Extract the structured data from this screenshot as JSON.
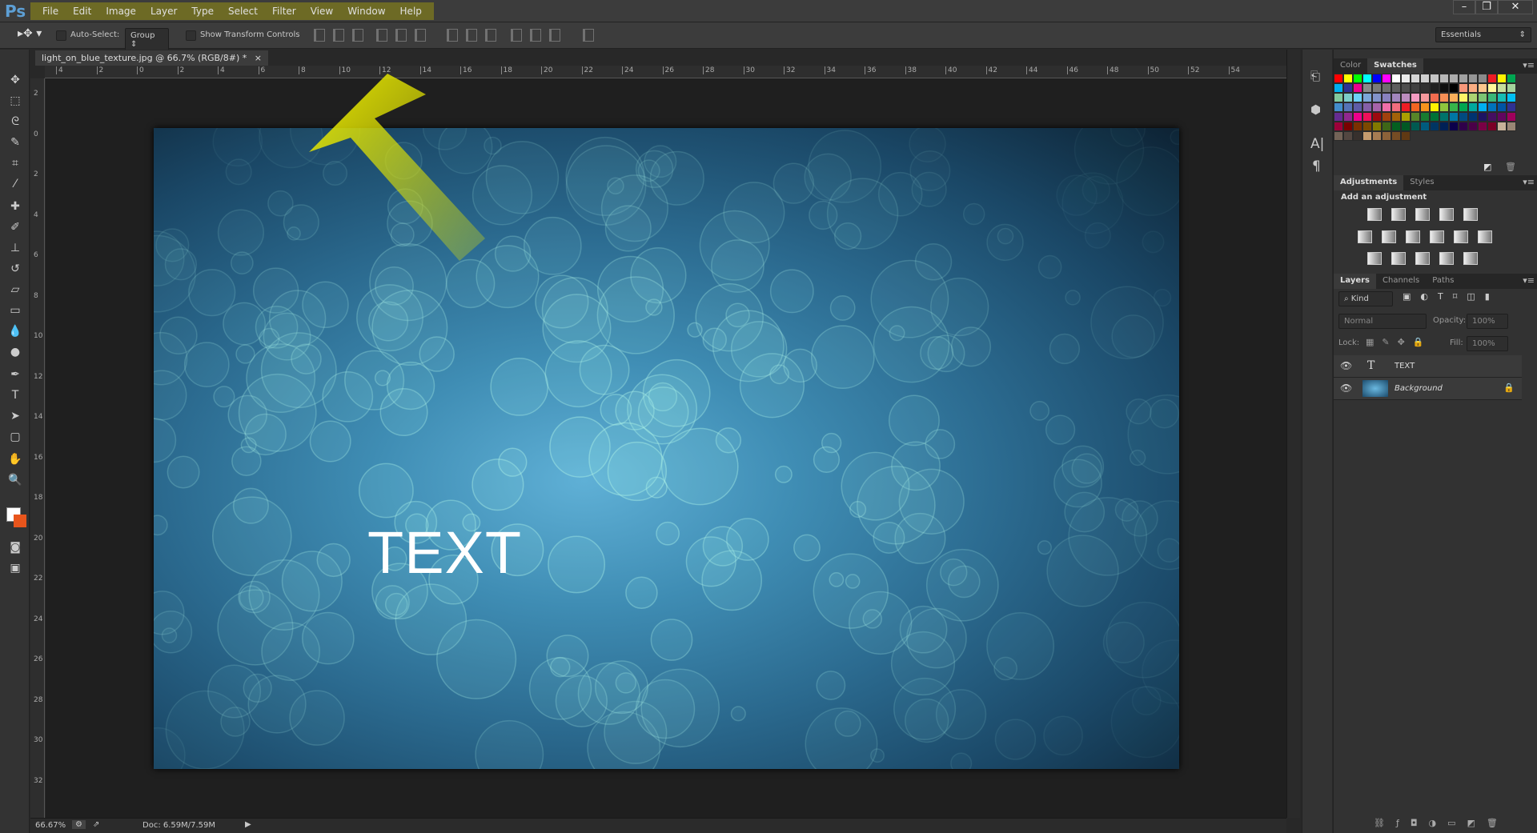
{
  "app": {
    "logo": "Ps"
  },
  "menu": [
    "File",
    "Edit",
    "Image",
    "Layer",
    "Type",
    "Select",
    "Filter",
    "View",
    "Window",
    "Help"
  ],
  "window_controls": {
    "minimize": "–",
    "restore": "❐",
    "close": "✕"
  },
  "options": {
    "auto_select_label": "Auto-Select:",
    "auto_select_checked": false,
    "group_value": "Group",
    "show_transform_label": "Show Transform Controls",
    "show_transform_checked": false,
    "workspace": "Essentials"
  },
  "document": {
    "tab_title": "light_on_blue_texture.jpg @ 66.7% (RGB/8#) *",
    "close": "×",
    "text_layer_content": "TEXT"
  },
  "rulers": {
    "horizontal": [
      "4",
      "2",
      "0",
      "2",
      "4",
      "6",
      "8",
      "10",
      "12",
      "14",
      "16",
      "18",
      "20",
      "22",
      "24",
      "26",
      "28",
      "30",
      "32",
      "34",
      "36",
      "38",
      "40",
      "42",
      "44",
      "46",
      "48",
      "50",
      "52",
      "54"
    ],
    "vertical": [
      "2",
      "0",
      "2",
      "4",
      "6",
      "8",
      "10",
      "12",
      "14",
      "16",
      "18",
      "20",
      "22",
      "24",
      "26",
      "28",
      "30",
      "32"
    ]
  },
  "status": {
    "zoom": "66.67%",
    "doc": "Doc: 6.59M/7.59M"
  },
  "annotation": {
    "arrow_color": "#e5e600"
  },
  "panels": {
    "color_tabs": [
      "Color",
      "Swatches"
    ],
    "swatches": [
      "#ff0000",
      "#ffff00",
      "#00ff00",
      "#00ffff",
      "#0000ff",
      "#ff00ff",
      "#ffffff",
      "#ebebeb",
      "#d6d6d6",
      "#cfcfcf",
      "#c4c4c4",
      "#b8b8b8",
      "#adadad",
      "#a1a1a1",
      "#969696",
      "#8a8a8a",
      "#ed1c24",
      "#fff200",
      "#00a651",
      "#00aeef",
      "#2e3192",
      "#ec008c",
      "#8a8a8a",
      "#7a7a7a",
      "#6e6e6e",
      "#5e5e5e",
      "#4f4f4f",
      "#404040",
      "#303030",
      "#1f1f1f",
      "#0f0f0f",
      "#000000",
      "#f7977a",
      "#fbad82",
      "#fdc68c",
      "#fff799",
      "#c6df9c",
      "#a4d49d",
      "#81ca9d",
      "#7bcdc9",
      "#6ccff7",
      "#7ca6d8",
      "#8293ca",
      "#8881be",
      "#a286bd",
      "#bc8cbf",
      "#f49bc1",
      "#f5999d",
      "#f26c4f",
      "#f68e55",
      "#fbaf5a",
      "#fff467",
      "#acd372",
      "#7dc473",
      "#39b778",
      "#16bcb4",
      "#00bff3",
      "#438ccb",
      "#5573b7",
      "#5e5ca7",
      "#855fa8",
      "#a763a9",
      "#ef6ea8",
      "#f16d7e",
      "#ee1d24",
      "#f16522",
      "#f7941d",
      "#fff100",
      "#8fc63d",
      "#37b44a",
      "#00a650",
      "#00a99e",
      "#00aeef",
      "#0072bc",
      "#0054a5",
      "#2f3192",
      "#652c91",
      "#91278f",
      "#ed008c",
      "#ee105a",
      "#9d0a0f",
      "#a1410d",
      "#a36209",
      "#aba000",
      "#588528",
      "#197b30",
      "#007236",
      "#00736a",
      "#0076a4",
      "#004a80",
      "#003370",
      "#1d1363",
      "#450e61",
      "#62055f",
      "#9e005c",
      "#9d0039",
      "#790000",
      "#7b3000",
      "#7c4900",
      "#827a00",
      "#3e6617",
      "#045f20",
      "#005824",
      "#005951",
      "#005b7e",
      "#003562",
      "#002056",
      "#0c004b",
      "#30004a",
      "#4b0048",
      "#7a0045",
      "#7a0026",
      "#c7b299",
      "#998675",
      "#736357",
      "#534741",
      "#37302d",
      "#c69c6e",
      "#a67c52",
      "#8c6239",
      "#754c24",
      "#603913"
    ],
    "adjust_tabs": [
      "Adjustments",
      "Styles"
    ],
    "adjust_heading": "Add an adjustment",
    "layers_tabs": [
      "Layers",
      "Channels",
      "Paths"
    ],
    "filter_kind": "Kind",
    "blend_mode": "Normal",
    "opacity_label": "Opacity:",
    "opacity": "100%",
    "lock_label": "Lock:",
    "fill_label": "Fill:",
    "fill": "100%",
    "layers": [
      {
        "name": "TEXT",
        "type": "text",
        "visible": true
      },
      {
        "name": "Background",
        "type": "image",
        "visible": true,
        "locked": true
      }
    ]
  }
}
